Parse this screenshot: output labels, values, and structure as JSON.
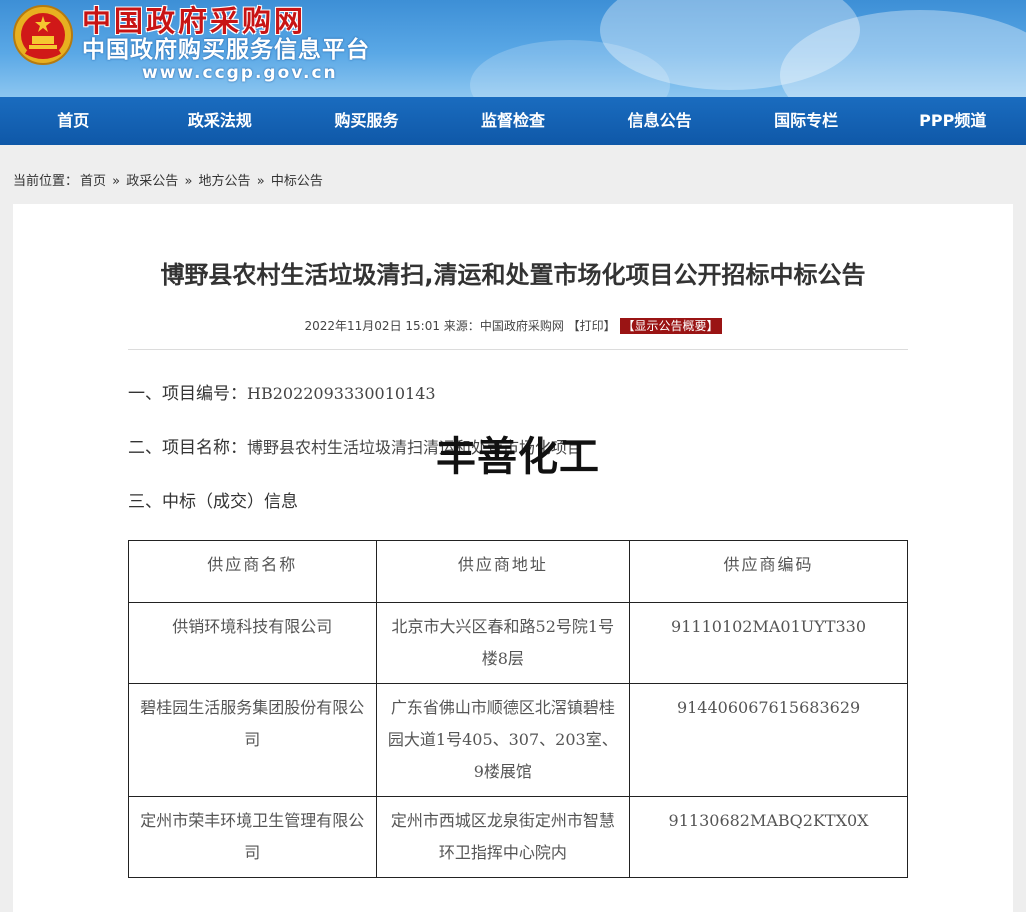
{
  "header": {
    "site_title": "中国政府采购网",
    "site_subtitle": "中国政府购买服务信息平台",
    "site_url": "www.ccgp.gov.cn"
  },
  "nav": {
    "items": [
      "首页",
      "政采法规",
      "购买服务",
      "监督检查",
      "信息公告",
      "国际专栏",
      "PPP频道"
    ]
  },
  "breadcrumb": {
    "label": "当前位置：",
    "items": [
      "首页",
      "政采公告",
      "地方公告",
      "中标公告"
    ],
    "separator": "»"
  },
  "article": {
    "title": "博野县农村生活垃圾清扫,清运和处置市场化项目公开招标中标公告",
    "datetime": "2022年11月02日 15:01",
    "source_label": "来源：",
    "source": "中国政府采购网",
    "print_label": "【打印】",
    "summary_label": "【显示公告概要】",
    "watermark": "丰善化工",
    "sections": {
      "project_no_label": "一、项目编号：",
      "project_no": "HB2022093330010143",
      "project_name_label": "二、项目名称：",
      "project_name": "博野县农村生活垃圾清扫清运和处置市场化项目",
      "award_label": "三、中标（成交）信息"
    }
  },
  "suppliers_table": {
    "headers": [
      "供应商名称",
      "供应商地址",
      "供应商编码"
    ],
    "rows": [
      {
        "name": "供销环境科技有限公司",
        "address": "北京市大兴区春和路52号院1号楼8层",
        "code": "91110102MA01UYT330"
      },
      {
        "name": "碧桂园生活服务集团股份有限公司",
        "address": "广东省佛山市顺德区北滘镇碧桂园大道1号405、307、203室、9楼展馆",
        "code": "914406067615683629"
      },
      {
        "name": "定州市荣丰环境卫生管理有限公司",
        "address": "定州市西城区龙泉街定州市智慧环卫指挥中心院内",
        "code": "91130682MABQ2KTX0X"
      }
    ]
  },
  "colors": {
    "header_blue": "#3d8fd6",
    "nav_blue": "#1a6cbf",
    "title_red": "#c81414",
    "summary_bg": "#9a1414"
  }
}
